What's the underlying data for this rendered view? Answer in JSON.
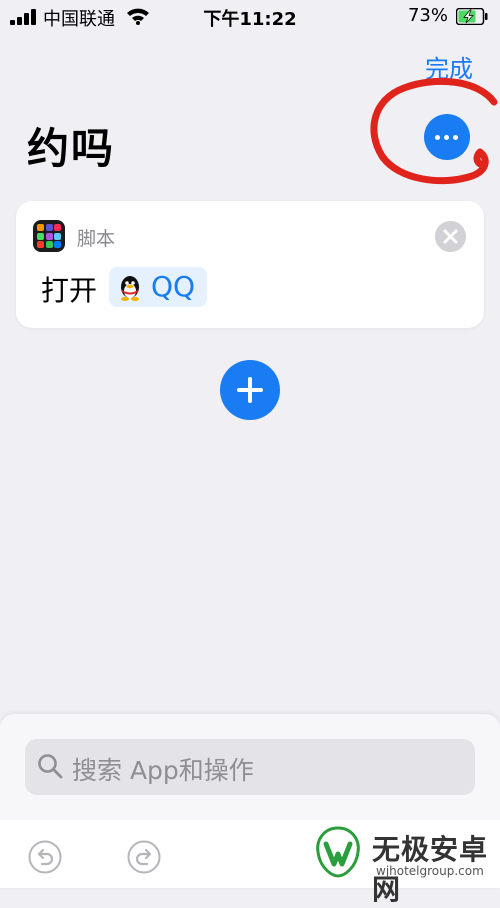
{
  "status_bar": {
    "carrier": "中国联通",
    "time": "下午11:22",
    "battery_percent": "73%",
    "battery_level": 0.73
  },
  "header": {
    "done_label": "完成",
    "title": "约吗",
    "more_button": "ellipsis-icon"
  },
  "action_card": {
    "category_label": "脚本",
    "category_icon": "scripting-grid-icon",
    "verb": "打开",
    "app_name": "QQ",
    "app_icon": "qq-penguin-icon",
    "remove_icon": "close-icon"
  },
  "add_button": {
    "icon": "plus-icon"
  },
  "bottom_sheet": {
    "search_placeholder": "搜索 App和操作",
    "undo_icon": "undo-icon",
    "redo_icon": "redo-icon"
  },
  "watermark": {
    "title": "无极安卓网",
    "subtitle": "wjhotelgroup.com"
  },
  "colors": {
    "accent": "#1a7cf2",
    "annotation": "#e0241b",
    "background": "#efeff4"
  }
}
